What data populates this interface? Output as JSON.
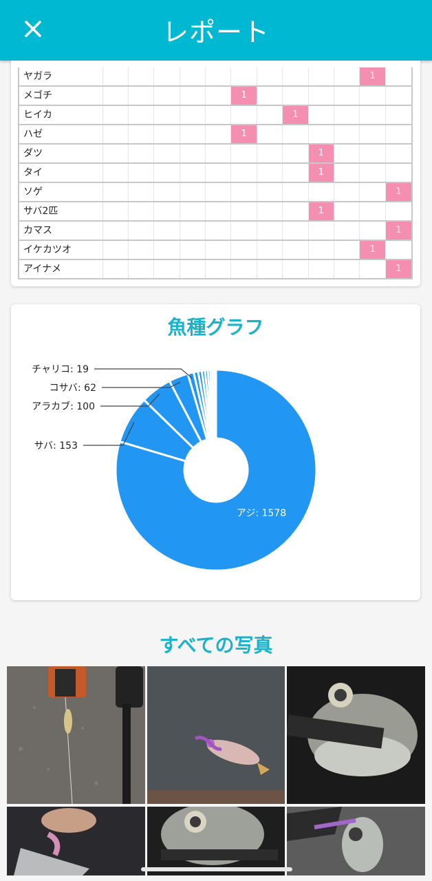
{
  "header": {
    "title": "レポート",
    "close_icon": "close-icon"
  },
  "catch_table": {
    "rows": [
      {
        "name": "ヤガラ",
        "col": 10,
        "count": "1"
      },
      {
        "name": "メゴチ",
        "col": 5,
        "count": "1"
      },
      {
        "name": "ヒイカ",
        "col": 7,
        "count": "1"
      },
      {
        "name": "ハゼ",
        "col": 5,
        "count": "1"
      },
      {
        "name": "ダツ",
        "col": 8,
        "count": "1"
      },
      {
        "name": "タイ",
        "col": 8,
        "count": "1"
      },
      {
        "name": "ソゲ",
        "col": 11,
        "count": "1"
      },
      {
        "name": "サバ2匹",
        "col": 8,
        "count": "1"
      },
      {
        "name": "カマス",
        "col": 11,
        "count": "1"
      },
      {
        "name": "イケカツオ",
        "col": 10,
        "count": "1"
      },
      {
        "name": "アイナメ",
        "col": 11,
        "count": "1"
      }
    ]
  },
  "chart_section": {
    "title": "魚種グラフ"
  },
  "chart_data": {
    "type": "pie",
    "labels": [
      "アジ",
      "サバ",
      "アラカブ",
      "コサバ",
      "チャリコ"
    ],
    "values": [
      1578,
      153,
      100,
      62,
      19
    ],
    "slice_labels": [
      "アジ: 1578",
      "サバ: 153",
      "アラカブ: 100",
      "コサバ: 62",
      "チャリコ: 19"
    ],
    "color": "#2196f3"
  },
  "photos_section": {
    "title": "すべての写真"
  }
}
